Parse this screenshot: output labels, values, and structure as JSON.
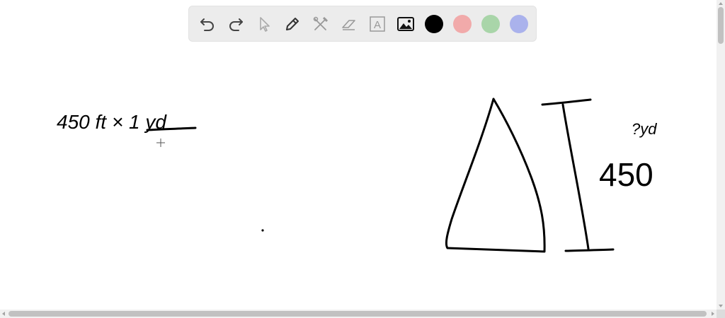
{
  "toolbar": {
    "tools": [
      {
        "name": "undo-icon",
        "label": "Undo"
      },
      {
        "name": "redo-icon",
        "label": "Redo"
      },
      {
        "name": "select-icon",
        "label": "Select"
      },
      {
        "name": "pen-icon",
        "label": "Pen"
      },
      {
        "name": "tools-icon",
        "label": "Tools"
      },
      {
        "name": "eraser-icon",
        "label": "Eraser"
      },
      {
        "name": "text-icon",
        "label": "A"
      },
      {
        "name": "image-icon",
        "label": "Image"
      }
    ],
    "colors": [
      "#000000",
      "#f1aaaa",
      "#a9d5a9",
      "#aab2ec"
    ]
  },
  "canvas": {
    "left_note": "450 ft × 1 yd",
    "right_note_top": "?yd",
    "right_note_value": "450"
  }
}
